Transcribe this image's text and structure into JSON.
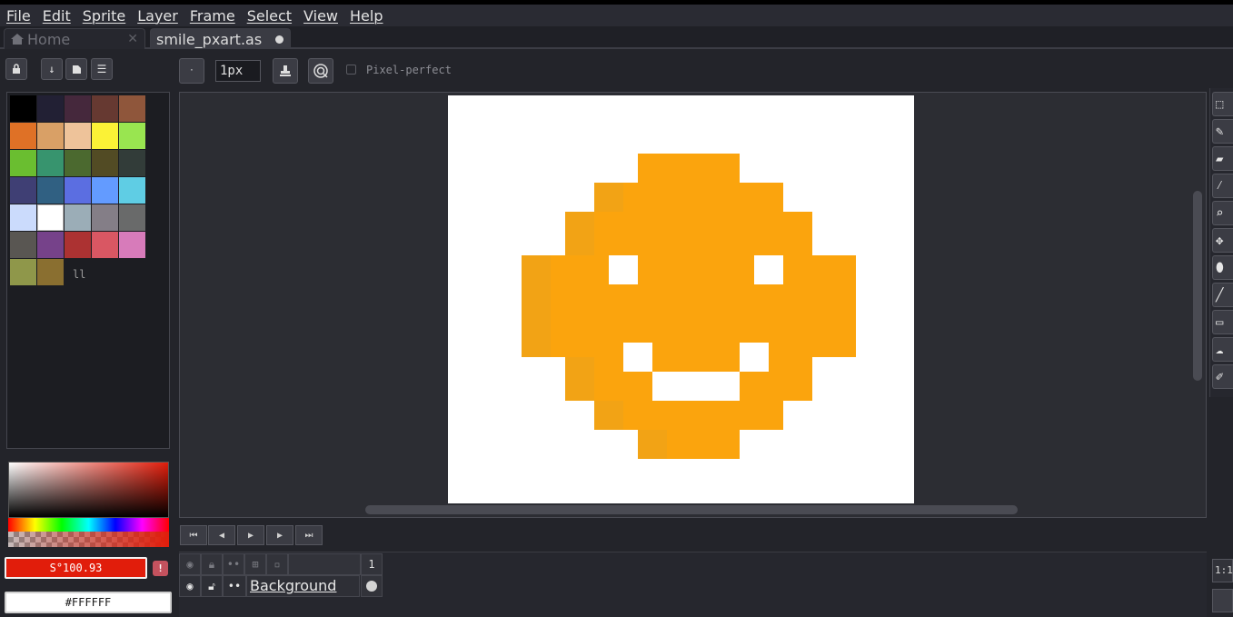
{
  "menu": [
    "File",
    "Edit",
    "Sprite",
    "Layer",
    "Frame",
    "Select",
    "View",
    "Help"
  ],
  "tabs": {
    "home": {
      "label": "Home",
      "icon": "home-icon"
    },
    "file": {
      "label": "smile_pxart.as"
    }
  },
  "context_bar": {
    "brush_size": "1px",
    "pixel_perfect_label": "Pixel-perfect",
    "pixel_perfect_checked": false
  },
  "palette": {
    "colors": [
      "#000000",
      "#222034",
      "#45283c",
      "#663931",
      "#8f563b",
      "#df7126",
      "#d9a066",
      "#eec39a",
      "#fbf236",
      "#99e550",
      "#6abe30",
      "#37946e",
      "#4b692f",
      "#524b24",
      "#323c39",
      "#3f3f74",
      "#306082",
      "#5b6ee1",
      "#639bff",
      "#5fcde4",
      "#cbdbfc",
      "#ffffff",
      "#9badb7",
      "#847e87",
      "#696a6a",
      "#595652",
      "#76428a",
      "#ac3232",
      "#d95763",
      "#d77bba",
      "#8f974a",
      "#8a6f30"
    ],
    "selected": "#ffffff"
  },
  "color": {
    "foreground_label": "S°100.93",
    "foreground_hex": "#e11d0b",
    "background_label": "#FFFFFF"
  },
  "sprite": {
    "background": "#ffffff",
    "face_color": "#fba40d",
    "shade_color": "#f2a315"
  },
  "timeline": {
    "layer_name": "Background",
    "frame_number": "1"
  },
  "zoom_label": "1:1"
}
